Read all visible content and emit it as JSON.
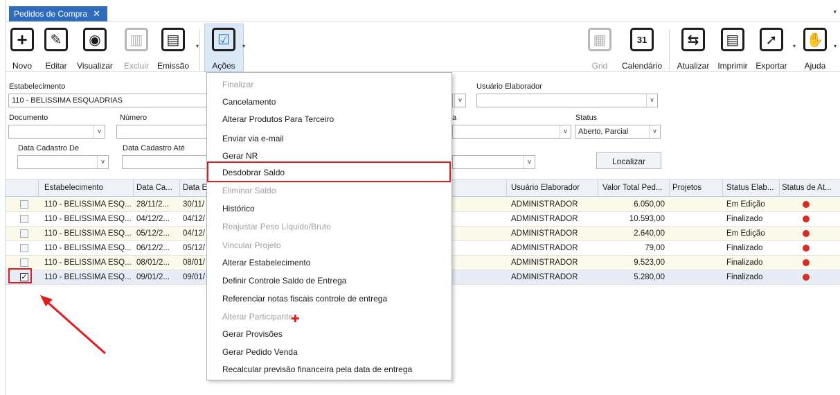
{
  "tab": {
    "label": "Pedidos de Compra",
    "close": "✕",
    "menu_arrow": "▾"
  },
  "toolbar": {
    "novo": "Novo",
    "editar": "Editar",
    "visualizar": "Visualizar",
    "excluir": "Excluir",
    "emissao": "Emissão",
    "acoes": "Ações",
    "grid": "Grid",
    "calendario": "Calendário",
    "atualizar": "Atualizar",
    "imprimir": "Imprimir",
    "exportar": "Exportar",
    "ajuda": "Ajuda",
    "calendar_day": "31"
  },
  "filters": {
    "estabelecimento_label": "Estabelecimento",
    "estabelecimento_value": "110 - BELISSIMA ESQUADRIAS",
    "usuario_label": "Usuário Elaborador",
    "documento_label": "Documento",
    "numero_label": "Número",
    "partial_label_a": "a",
    "status_label": "Status",
    "status_value": "Aberto, Parcial",
    "data_de_label": "Data Cadastro De",
    "data_ate_label": "Data Cadastro Até",
    "localizar": "Localizar"
  },
  "grid": {
    "columns": [
      "Estabelecimento",
      "Data Ca...",
      "Data E",
      "Usuário Elaborador",
      "Valor Total Ped...",
      "Projetos",
      "Status Elab...",
      "Status de At..."
    ],
    "rows": [
      {
        "est": "110 - BELISSIMA ESQ...",
        "dc": "28/11/2...",
        "de": "30/11/",
        "user": "ADMINISTRADOR",
        "valor": "6.050,00",
        "status": "Em Edição",
        "checked": false
      },
      {
        "est": "110 - BELISSIMA ESQ...",
        "dc": "04/12/2...",
        "de": "04/12/",
        "user": "ADMINISTRADOR",
        "valor": "10.593,00",
        "status": "Finalizado",
        "checked": false
      },
      {
        "est": "110 - BELISSIMA ESQ...",
        "dc": "05/12/2...",
        "de": "04/12/",
        "user": "ADMINISTRADOR",
        "valor": "2.640,00",
        "status": "Em Edição",
        "checked": false
      },
      {
        "est": "110 - BELISSIMA ESQ...",
        "dc": "06/12/2...",
        "de": "05/12/",
        "user": "ADMINISTRADOR",
        "valor": "79,00",
        "status": "Finalizado",
        "checked": false
      },
      {
        "est": "110 - BELISSIMA ESQ...",
        "dc": "08/01/2...",
        "de": "08/01/",
        "user": "ADMINISTRADOR",
        "valor": "9.523,00",
        "status": "Finalizado",
        "checked": false
      },
      {
        "est": "110 - BELISSIMA ESQ...",
        "dc": "09/01/2...",
        "de": "09/01/",
        "user": "ADMINISTRADOR",
        "valor": "5.280,00",
        "status": "Finalizado",
        "checked": true
      }
    ],
    "status_dot_color": "#d72c24",
    "check_mark": "✓"
  },
  "menu": {
    "items": [
      {
        "label": "Finalizar",
        "disabled": true
      },
      {
        "label": "Cancelamento",
        "disabled": false
      },
      {
        "label": "Alterar Produtos Para Terceiro",
        "disabled": false
      },
      {
        "label": "Enviar via e-mail",
        "disabled": false
      },
      {
        "label": "Gerar NR",
        "disabled": false
      },
      {
        "label": "Desdobrar Saldo",
        "disabled": false
      },
      {
        "label": "Eliminar Saldo",
        "disabled": true
      },
      {
        "label": "Histórico",
        "disabled": false
      },
      {
        "label": "Reajustar Peso Líquido/Bruto",
        "disabled": true
      },
      {
        "label": "Vincular Projeto",
        "disabled": true
      },
      {
        "label": "Alterar Estabelecimento",
        "disabled": false
      },
      {
        "label": "Definir Controle Saldo de Entrega",
        "disabled": false
      },
      {
        "label": "Referenciar notas fiscais controle de entrega",
        "disabled": false
      },
      {
        "label": "Alterar Participante",
        "disabled": true
      },
      {
        "label": "Gerar Provisões",
        "disabled": false
      },
      {
        "label": "Gerar Pedido Venda",
        "disabled": false
      },
      {
        "label": "Recalcular previsão financeira pela data de entrega",
        "disabled": false
      }
    ],
    "highlighted": "Desdobrar Saldo"
  },
  "colors": {
    "accent": "#2f6cbd",
    "highlight_outline": "#e01d1d"
  }
}
